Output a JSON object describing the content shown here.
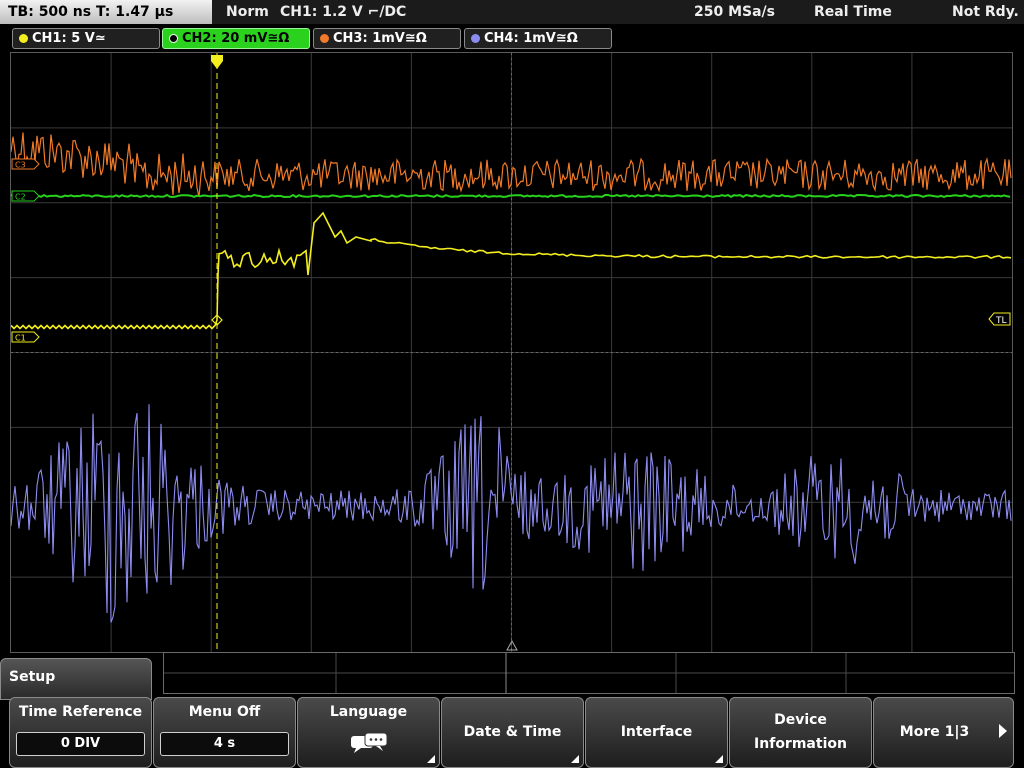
{
  "status": {
    "timebase": "TB: 500 ns",
    "trigger_time": "T: 1.47 μs",
    "trigger_mode": "Norm",
    "trigger_info": "CH1: 1.2 V ⌐/DC",
    "sample_rate": "250 MSa/s",
    "acq_mode": "Real Time",
    "state": "Not Rdy."
  },
  "channels": [
    {
      "id": "ch1",
      "label": "CH1: 5 V≃",
      "color": "#f3ee1f"
    },
    {
      "id": "ch2",
      "label": "CH2: 20 mV≅Ω",
      "color": "#28d21c"
    },
    {
      "id": "ch3",
      "label": "CH3: 1mV≅Ω",
      "color": "#f07a28"
    },
    {
      "id": "ch4",
      "label": "CH4: 1mV≅Ω",
      "color": "#8c8cf0"
    }
  ],
  "markers": {
    "c3": "C3",
    "c2": "C2",
    "c1": "C1",
    "trigger_level": "TL"
  },
  "menu": {
    "title": "Setup",
    "softkeys": [
      {
        "label": "Time Reference",
        "value": "0 DIV"
      },
      {
        "label": "Menu Off",
        "value": "4 s"
      },
      {
        "label": "Language",
        "icon": "speech-bubbles-icon"
      },
      {
        "label": "Date & Time"
      },
      {
        "label": "Interface"
      },
      {
        "label_line1": "Device",
        "label_line2": "Information"
      },
      {
        "label": "More 1|3"
      }
    ]
  }
}
